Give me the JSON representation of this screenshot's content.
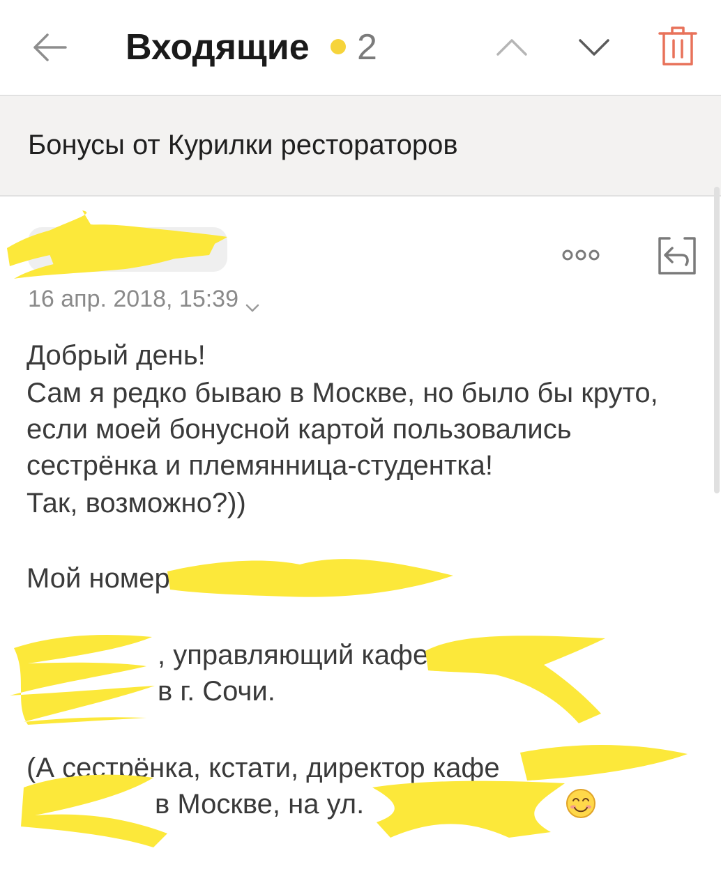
{
  "header": {
    "title": "Входящие",
    "unread_count": "2",
    "accent_dot_color": "#f6d43b",
    "trash_color": "#e8725a",
    "icons": [
      "back-arrow-icon",
      "chevron-up-icon",
      "chevron-down-icon",
      "trash-icon"
    ]
  },
  "subject": "Бонусы от Курилки рестораторов",
  "message": {
    "date": "16 апр. 2018, 15:39",
    "icons": [
      "more-dots-icon",
      "reply-icon",
      "chevron-down-icon"
    ],
    "body": {
      "line1": "Добрый день!",
      "line2": "Сам я редко бываю в Москве, но было бы круто,",
      "line3": "если моей бонусной картой пользовались",
      "line4": "сестрёнка и племянница-студентка!",
      "line5": "Так, возможно?))",
      "line6": "Мой номер",
      "line7": ", управляющий кафе",
      "line8": "в г. Сочи.",
      "line9": "(А сестрёнка, кстати, директор кафе",
      "line10": "в Москве, на ул."
    },
    "emoji": "smiling-face-icon"
  },
  "redaction_color": "#fce83a"
}
